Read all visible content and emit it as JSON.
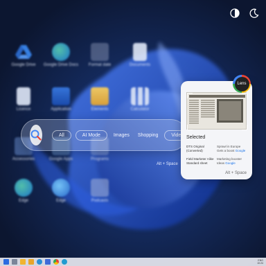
{
  "theme": {
    "light_icon": "half-circle-icon",
    "dark_icon": "moon-icon"
  },
  "desktop": {
    "icons": [
      {
        "label": "Google Drive"
      },
      {
        "label": "Google Drive Docs"
      },
      {
        "label": "Format date"
      },
      {
        "label": "Documents"
      },
      {
        "label": "Licence"
      },
      {
        "label": "Application"
      },
      {
        "label": "Elements"
      },
      {
        "label": "Calculator"
      },
      {
        "label": "Accessories"
      },
      {
        "label": "Google Apps"
      },
      {
        "label": "Programs"
      },
      {
        "label": "Edge"
      },
      {
        "label": "Edge"
      },
      {
        "label": "Podcasts"
      }
    ]
  },
  "search": {
    "chips": [
      "All",
      "AI Mode",
      "Images",
      "Shopping",
      "Videos"
    ],
    "hint": "Alt + Space"
  },
  "lens": {
    "badge": "Lens",
    "heading": "Selected",
    "rows": [
      {
        "c1a": "DTS Original",
        "c1b": "(Converted)",
        "c2a": "Sprawl in Europe",
        "c2b": "Gets a boost",
        "c2link": "Google"
      },
      {
        "c1a": "Field Marketer Alike",
        "c1b": "Standard sheet",
        "c2a": "Marketing booster",
        "c2b": "Ideas",
        "c2link": "Google"
      }
    ],
    "hint": "Alt + Space"
  },
  "taskbar": {
    "tray_line1": "ENG",
    "tray_line2": "10:24"
  }
}
